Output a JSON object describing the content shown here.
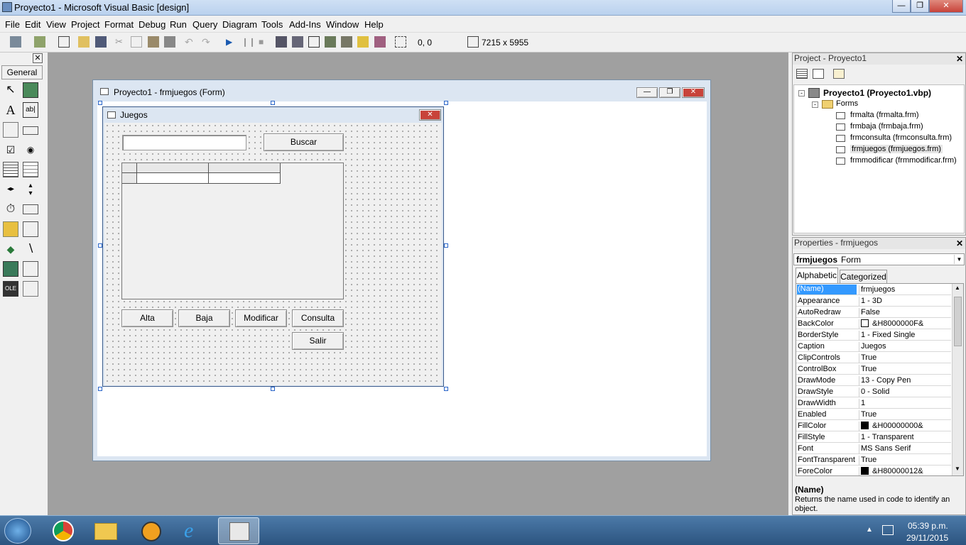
{
  "window": {
    "title": "Proyecto1 - Microsoft Visual Basic [design]"
  },
  "menu": [
    "File",
    "Edit",
    "View",
    "Project",
    "Format",
    "Debug",
    "Run",
    "Query",
    "Diagram",
    "Tools",
    "Add-Ins",
    "Window",
    "Help"
  ],
  "toolbar": {
    "position": "0, 0",
    "size": "7215 x 5955"
  },
  "toolbox": {
    "tab": "General"
  },
  "form_window": {
    "title": "Proyecto1 - frmjuegos (Form)"
  },
  "form": {
    "caption": "Juegos",
    "search_value": "",
    "buscar_label": "Buscar",
    "buttons": {
      "alta": "Alta",
      "baja": "Baja",
      "modificar": "Modificar",
      "consulta": "Consulta",
      "salir": "Salir"
    }
  },
  "project": {
    "title": "Project - Proyecto1",
    "root": "Proyecto1 (Proyecto1.vbp)",
    "folder": "Forms",
    "items": [
      "frmalta (frmalta.frm)",
      "frmbaja (frmbaja.frm)",
      "frmconsulta (frmconsulta.frm)",
      "frmjuegos (frmjuegos.frm)",
      "frmmodificar (frmmodificar.frm)"
    ]
  },
  "properties": {
    "title": "Properties - frmjuegos",
    "object_name": "frmjuegos",
    "object_type": "Form",
    "tabs": {
      "alphabetic": "Alphabetic",
      "categorized": "Categorized"
    },
    "rows": [
      {
        "name": "(Name)",
        "value": "frmjuegos"
      },
      {
        "name": "Appearance",
        "value": "1 - 3D"
      },
      {
        "name": "AutoRedraw",
        "value": "False"
      },
      {
        "name": "BackColor",
        "value": "&H8000000F&",
        "swatch": "#ffffff"
      },
      {
        "name": "BorderStyle",
        "value": "1 - Fixed Single"
      },
      {
        "name": "Caption",
        "value": "Juegos"
      },
      {
        "name": "ClipControls",
        "value": "True"
      },
      {
        "name": "ControlBox",
        "value": "True"
      },
      {
        "name": "DrawMode",
        "value": "13 - Copy Pen"
      },
      {
        "name": "DrawStyle",
        "value": "0 - Solid"
      },
      {
        "name": "DrawWidth",
        "value": "1"
      },
      {
        "name": "Enabled",
        "value": "True"
      },
      {
        "name": "FillColor",
        "value": "&H00000000&",
        "swatch": "#000000"
      },
      {
        "name": "FillStyle",
        "value": "1 - Transparent"
      },
      {
        "name": "Font",
        "value": "MS Sans Serif"
      },
      {
        "name": "FontTransparent",
        "value": "True"
      },
      {
        "name": "ForeColor",
        "value": "&H80000012&",
        "swatch": "#000000"
      }
    ],
    "desc_title": "(Name)",
    "desc_text": "Returns the name used in code to identify an object."
  },
  "taskbar": {
    "time": "05:39 p.m.",
    "date": "29/11/2015"
  },
  "colors": {
    "selection": "#3399ff",
    "titlebar": "#b9d1ee",
    "taskbar": "#2c5480",
    "close": "#c8433a"
  }
}
